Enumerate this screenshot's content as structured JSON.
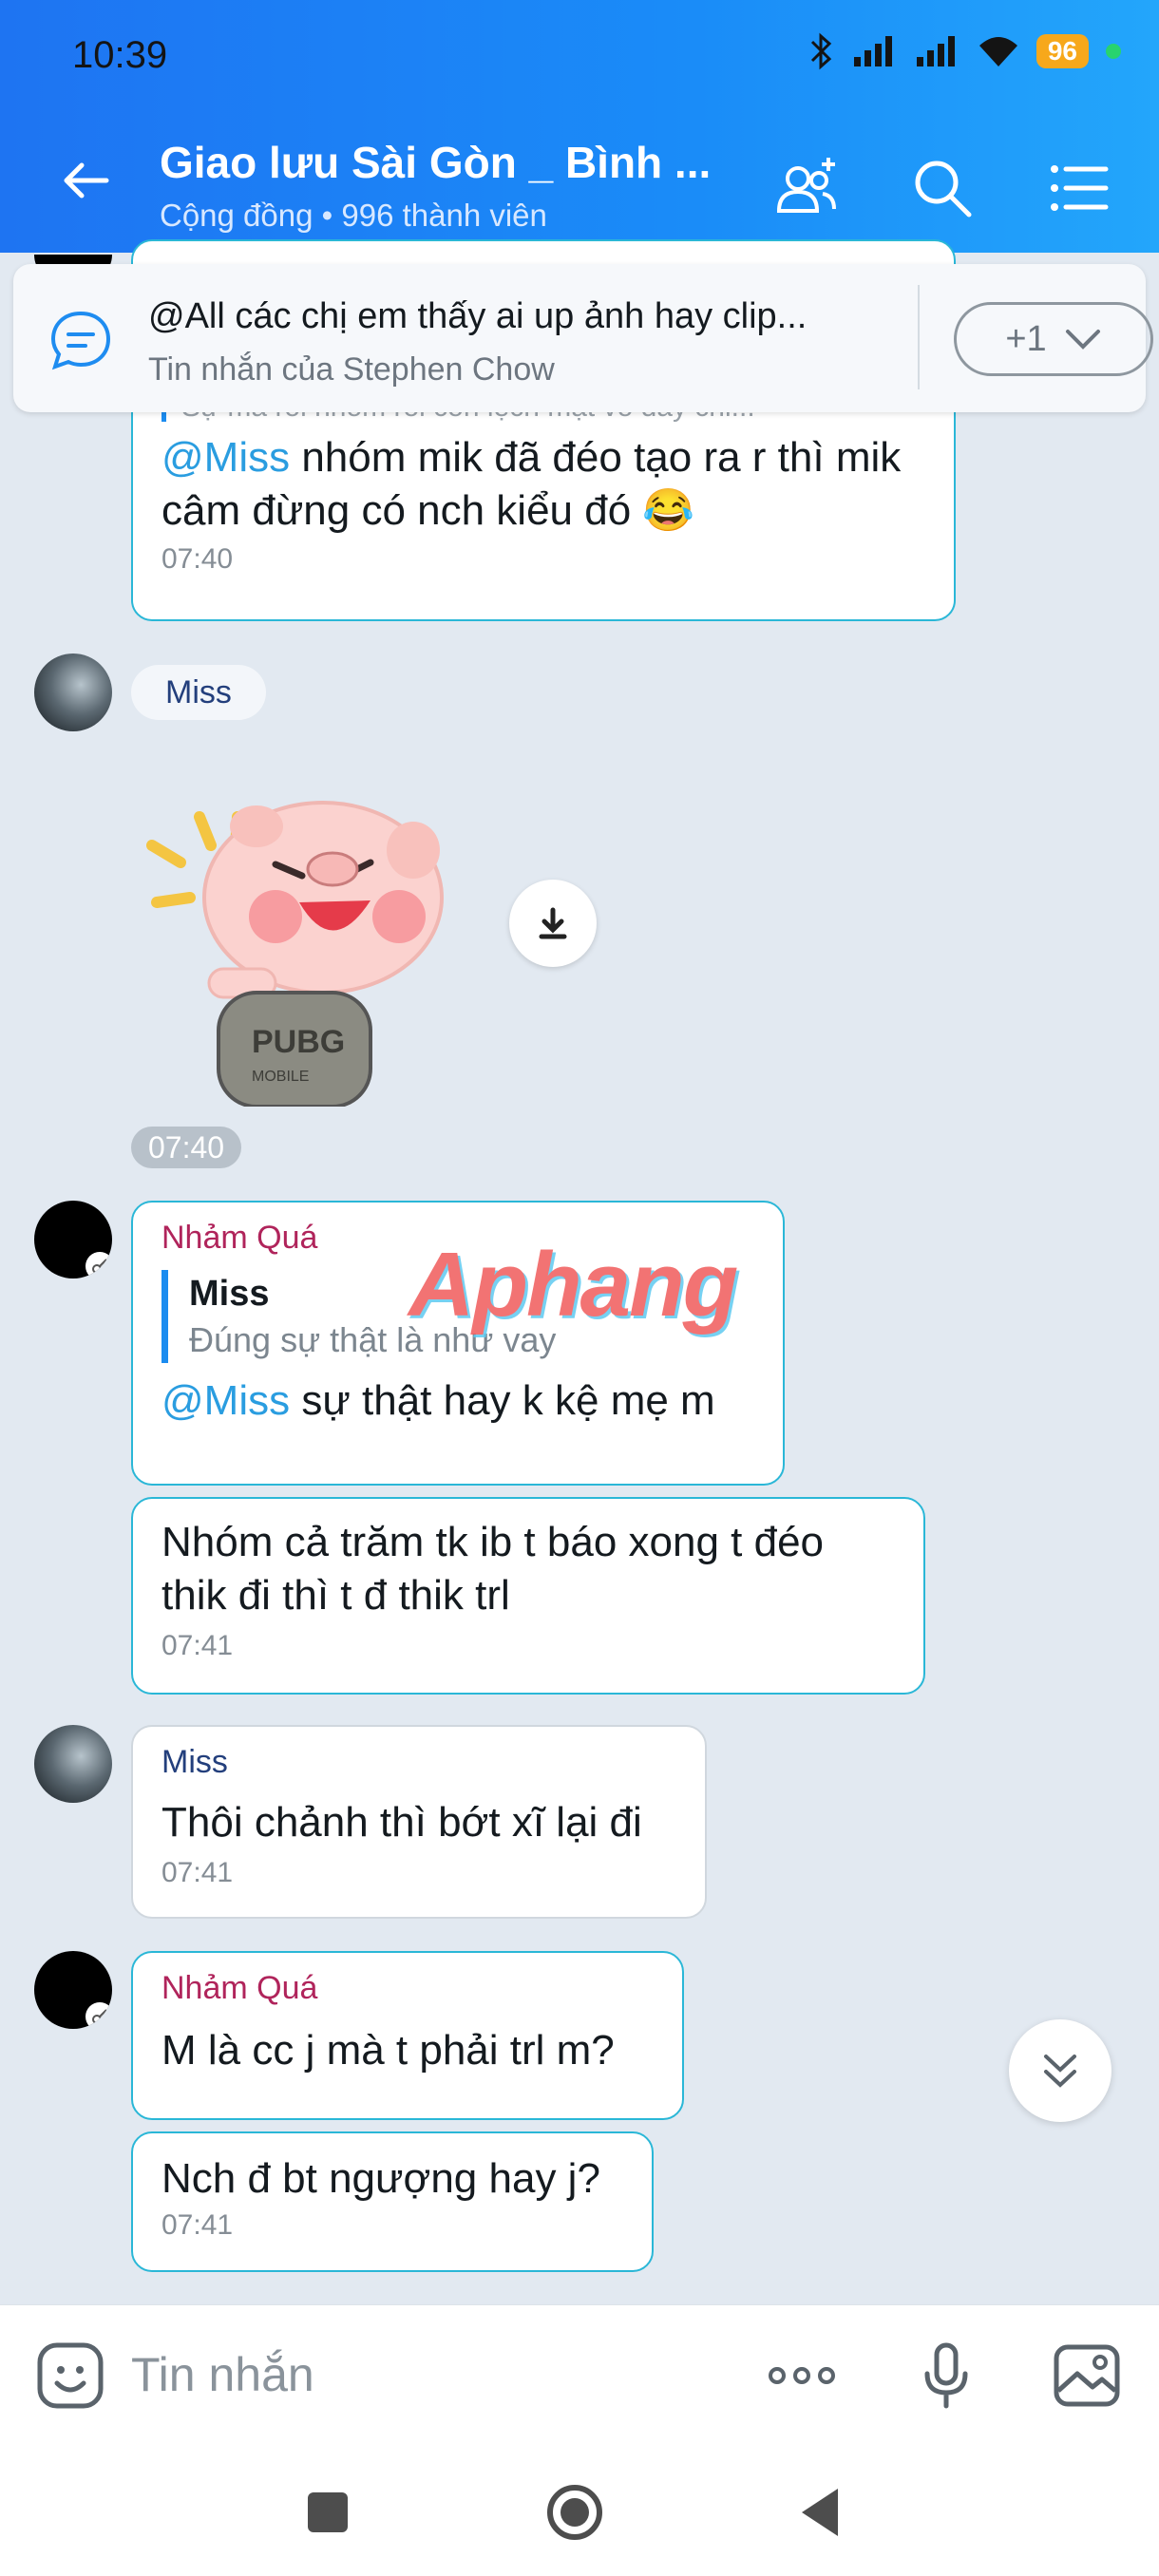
{
  "status": {
    "time": "10:39",
    "battery": "96"
  },
  "header": {
    "title": "Giao lưu Sài Gòn _ Bình ...",
    "subtitle": "Cộng đồng • 996 thành viên"
  },
  "pinned": {
    "text": "@All các chị em thấy ai up ảnh hay clip...",
    "sub": "Tin nhắn của Stephen Chow",
    "count": "+1"
  },
  "messages": {
    "m1": {
      "partial": "Sự mà rồi nhóm rồi còn lệch mặt vô đây chi...",
      "mention": "@Miss",
      "text": " nhóm mik đã đéo tạo ra r thì mik câm đừng có nch kiểu đó",
      "emoji": "😂",
      "time": "07:40"
    },
    "miss_label": "Miss",
    "sticker_time": "07:40",
    "m2": {
      "sender": "Nhảm Quá",
      "quote_name": "Miss",
      "quote_text": "Đúng sự thật là như vay",
      "mention": "@Miss",
      "text": " sự thật hay k kệ mẹ m"
    },
    "m3": {
      "line1": "Nhóm cả trăm tk ib t báo xong t đéo",
      "line2": "thik đi thì t đ thik trl",
      "time": "07:41"
    },
    "m4": {
      "sender": "Miss",
      "text": "Thôi chảnh thì bớt xĩ lại đi",
      "time": "07:41"
    },
    "m5": {
      "sender": "Nhảm Quá",
      "text": "M là cc j mà t phải trl m?"
    },
    "m6": {
      "text": "Nch đ bt ngượng hay j?",
      "time": "07:41"
    }
  },
  "watermark": "Aphang",
  "input": {
    "placeholder": "Tin nhắn"
  },
  "colors": {
    "header_start": "#1e74f2",
    "header_end": "#23a6fb",
    "bubble_border": "#2ab7d7",
    "mention": "#2a9de0",
    "sender_pink": "#b0245b"
  },
  "icons": [
    "back-arrow-icon",
    "add-member-icon",
    "search-icon",
    "menu-icon",
    "chat-icon",
    "chevron-down-icon",
    "download-icon",
    "sticker-icon",
    "more-icon",
    "mic-icon",
    "image-icon"
  ]
}
